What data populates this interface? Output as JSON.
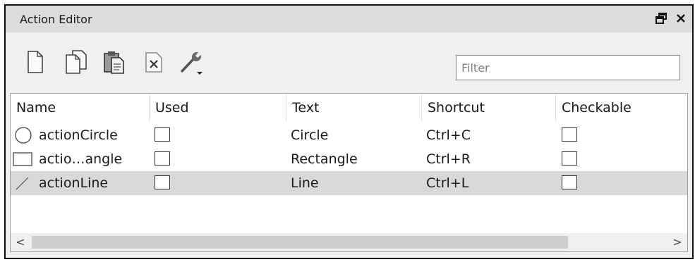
{
  "window": {
    "title": "Action Editor"
  },
  "toolbar": {
    "tools": [
      {
        "icon": "new-action-icon"
      },
      {
        "icon": "copy-action-icon"
      },
      {
        "icon": "paste-action-icon"
      },
      {
        "icon": "delete-action-icon"
      },
      {
        "icon": "configure-icon"
      }
    ],
    "filter_placeholder": "Filter",
    "filter_value": ""
  },
  "table": {
    "columns": [
      "Name",
      "Used",
      "Text",
      "Shortcut",
      "Checkable"
    ],
    "rows": [
      {
        "icon": "circle-icon",
        "name": "actionCircle",
        "used": false,
        "text": "Circle",
        "shortcut": "Ctrl+C",
        "checkable": false
      },
      {
        "icon": "rectangle-icon",
        "name": "actio…angle",
        "used": false,
        "text": "Rectangle",
        "shortcut": "Ctrl+R",
        "checkable": false
      },
      {
        "icon": "line-icon",
        "name": "actionLine",
        "used": false,
        "text": "Line",
        "shortcut": "Ctrl+L",
        "checkable": false
      }
    ],
    "selected_row": 2
  },
  "scrollbar": {
    "left_arrow": "<",
    "right_arrow": ">"
  }
}
